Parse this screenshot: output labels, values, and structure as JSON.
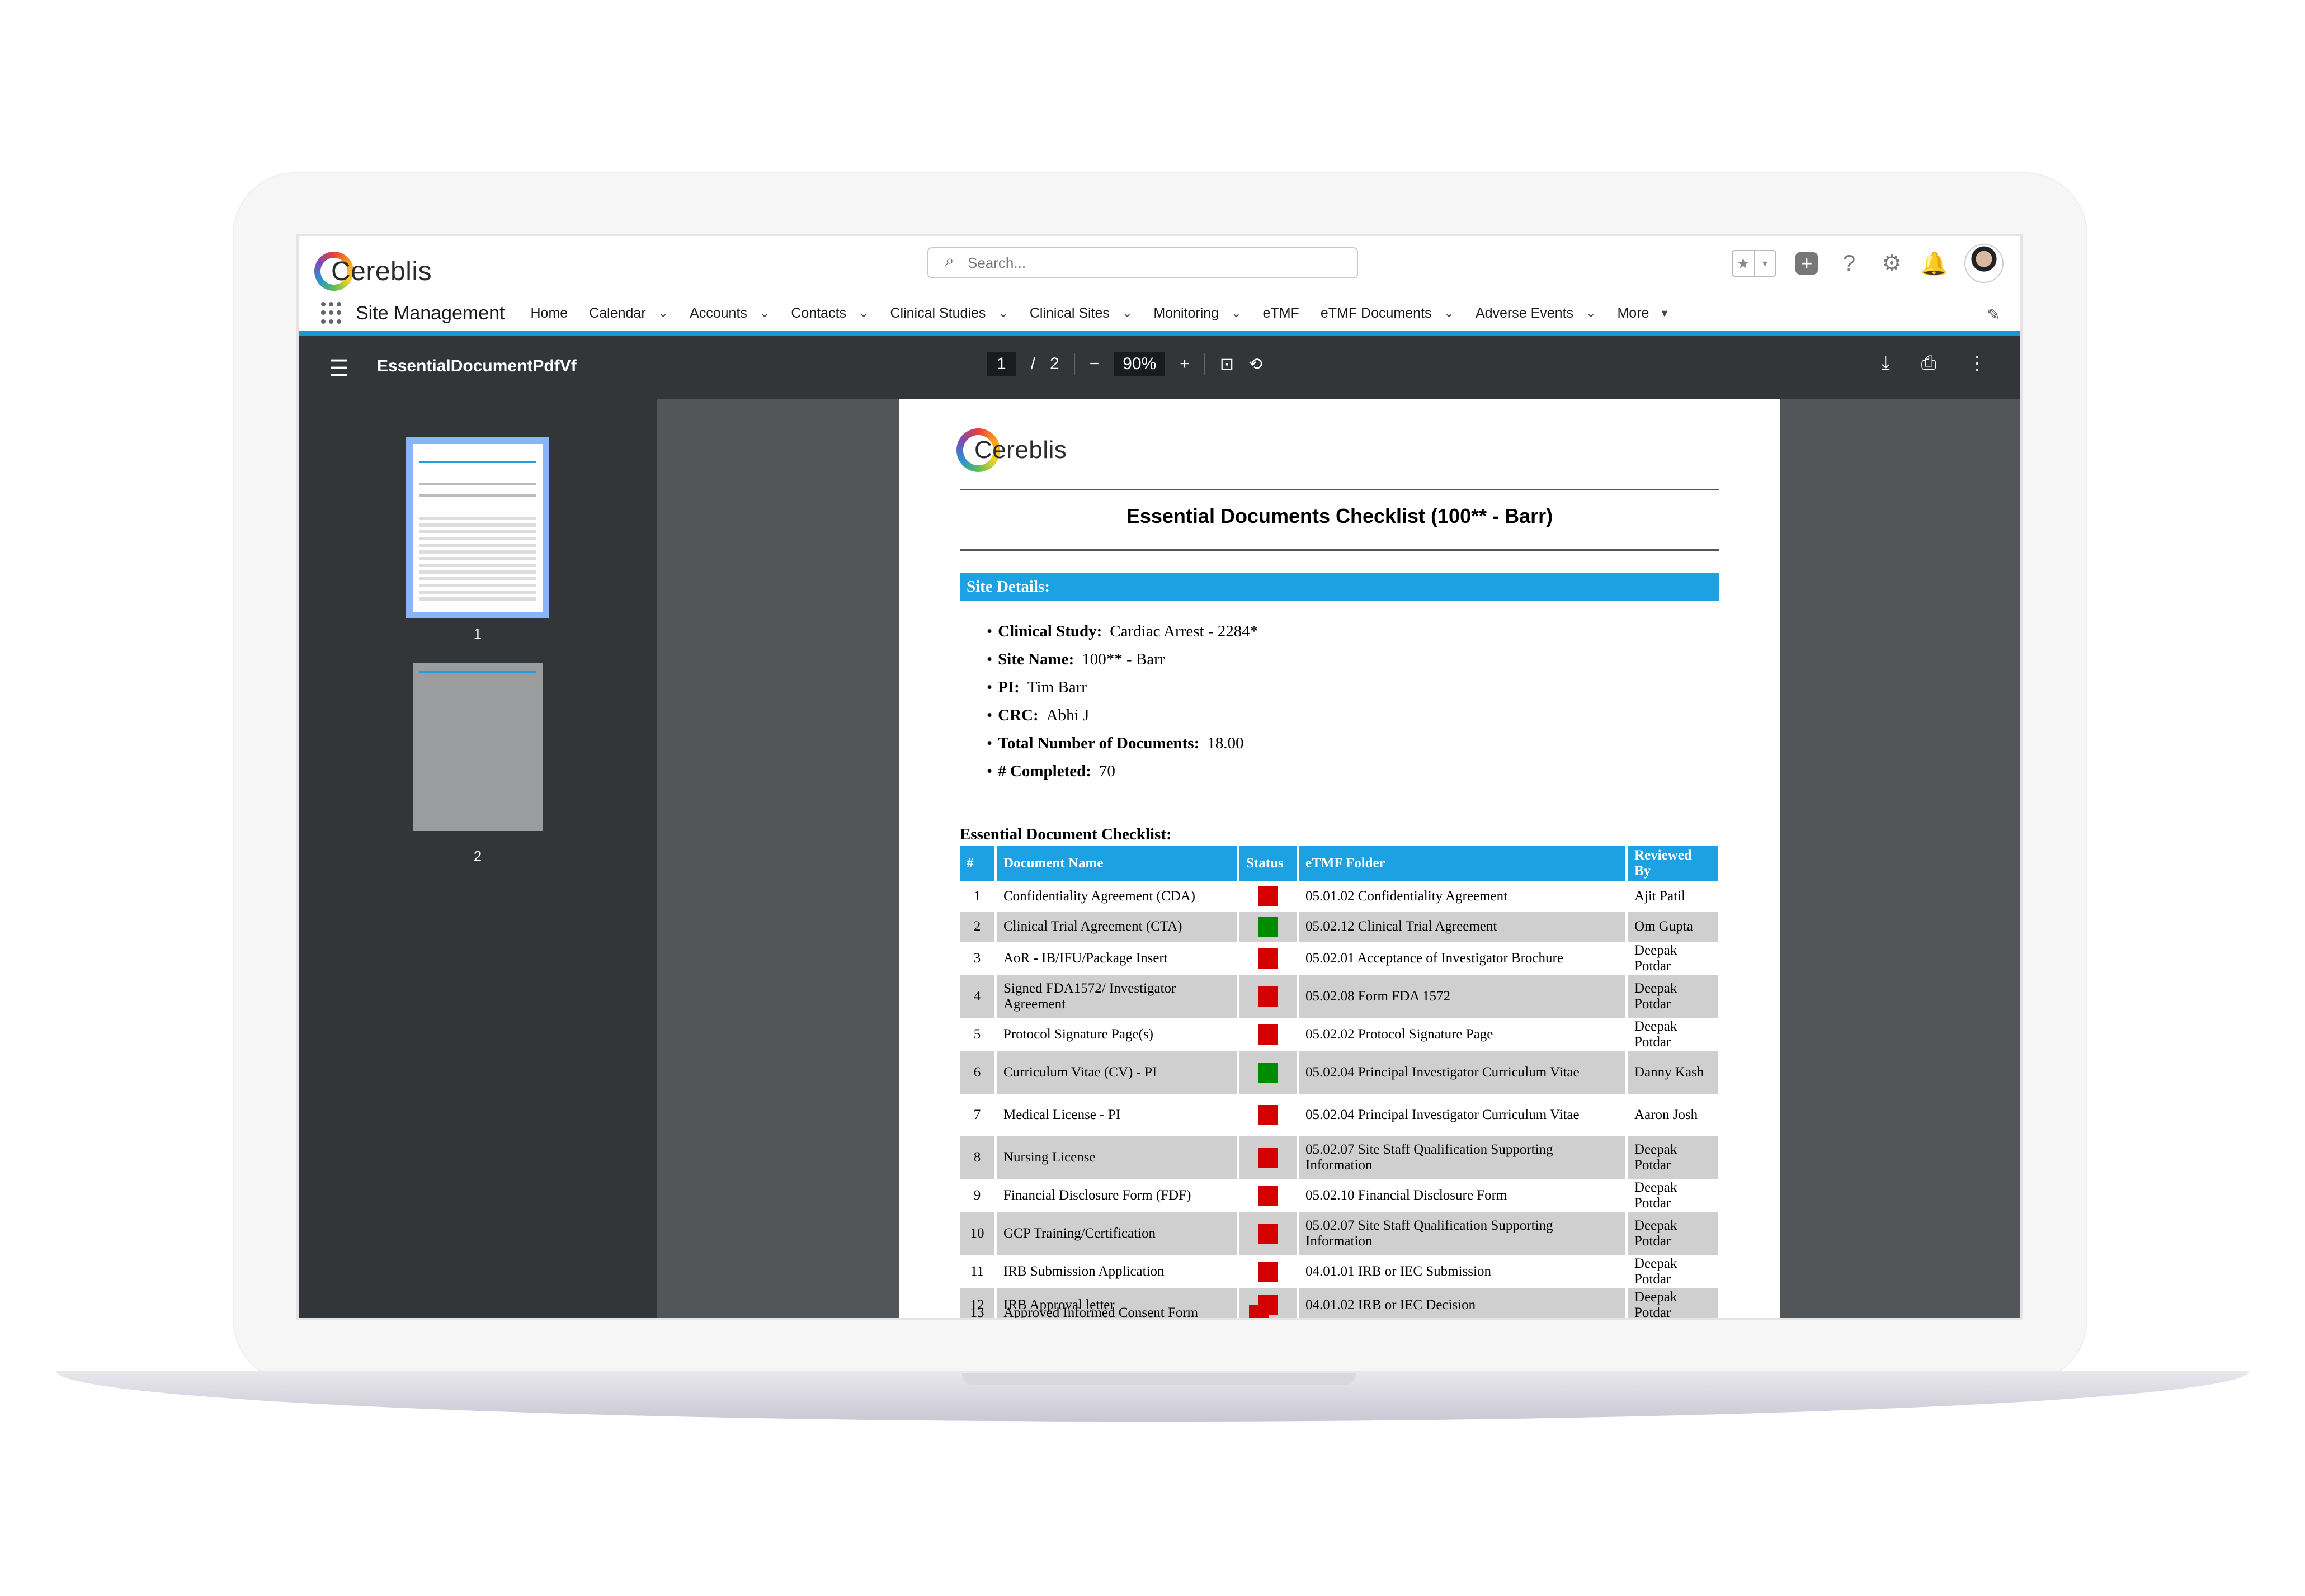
{
  "header": {
    "logo_text": "Cereblis",
    "search_placeholder": "Search...",
    "app_name": "Site Management",
    "nav": [
      {
        "label": "Home",
        "dropdown": false
      },
      {
        "label": "Calendar",
        "dropdown": true
      },
      {
        "label": "Accounts",
        "dropdown": true
      },
      {
        "label": "Contacts",
        "dropdown": true
      },
      {
        "label": "Clinical Studies",
        "dropdown": true
      },
      {
        "label": "Clinical Sites",
        "dropdown": true
      },
      {
        "label": "Monitoring",
        "dropdown": true
      },
      {
        "label": "eTMF",
        "dropdown": false
      },
      {
        "label": "eTMF Documents",
        "dropdown": true
      },
      {
        "label": "Adverse Events",
        "dropdown": true
      },
      {
        "label": "More",
        "dropdown": true
      }
    ],
    "icons": [
      "star-icon",
      "add-icon",
      "help-icon",
      "gear-icon",
      "bell-icon",
      "avatar"
    ]
  },
  "viewer": {
    "file_name": "EssentialDocumentPdfVf",
    "current_page": "1",
    "page_sep": "/",
    "total_pages": "2",
    "zoom": "90%",
    "thumbnails": [
      "1",
      "2"
    ]
  },
  "pdf": {
    "logo_text": "Cereblis",
    "title": "Essential Documents Checklist (100** - Barr)",
    "site_heading": "Site Details:",
    "details": [
      {
        "label": "Clinical Study:",
        "value": "Cardiac Arrest - 2284*"
      },
      {
        "label": "Site Name:",
        "value": "100** - Barr"
      },
      {
        "label": "PI:",
        "value": "Tim Barr"
      },
      {
        "label": "CRC:",
        "value": "Abhi J"
      },
      {
        "label": "Total Number of Documents:",
        "value": "18.00"
      },
      {
        "label": "# Completed:",
        "value": "70"
      }
    ],
    "checklist_title": "Essential Document Checklist:",
    "columns": [
      "#",
      "Document Name",
      "Status",
      "eTMF Folder",
      "Reviewed By"
    ],
    "rows": [
      {
        "num": "1",
        "name": "Confidentiality Agreement (CDA)",
        "status": "red",
        "folder": "05.01.02 Confidentiality Agreement",
        "reviewer": "Ajit Patil"
      },
      {
        "num": "2",
        "name": "Clinical Trial Agreement (CTA)",
        "status": "green",
        "folder": "05.02.12 Clinical Trial Agreement",
        "reviewer": "Om Gupta"
      },
      {
        "num": "3",
        "name": "AoR - IB/IFU/Package Insert",
        "status": "red",
        "folder": "05.02.01 Acceptance of Investigator Brochure",
        "reviewer": "Deepak Potdar"
      },
      {
        "num": "4",
        "name": "Signed FDA1572/ Investigator Agreement",
        "status": "red",
        "folder": "05.02.08 Form FDA 1572",
        "reviewer": "Deepak Potdar"
      },
      {
        "num": "5",
        "name": "Protocol Signature Page(s)",
        "status": "red",
        "folder": "05.02.02 Protocol Signature Page",
        "reviewer": "Deepak Potdar"
      },
      {
        "num": "6",
        "name": "Curriculum Vitae (CV) - PI",
        "status": "green",
        "folder": "05.02.04 Principal Investigator Curriculum Vitae",
        "reviewer": "Danny Kash"
      },
      {
        "num": "7",
        "name": "Medical License - PI",
        "status": "red",
        "folder": "05.02.04 Principal Investigator Curriculum Vitae",
        "reviewer": "Aaron Josh"
      },
      {
        "num": "8",
        "name": "Nursing License",
        "status": "red",
        "folder": "05.02.07 Site Staff Qualification Supporting Information",
        "reviewer": "Deepak Potdar"
      },
      {
        "num": "9",
        "name": "Financial Disclosure Form (FDF)",
        "status": "red",
        "folder": "05.02.10 Financial Disclosure Form",
        "reviewer": "Deepak Potdar"
      },
      {
        "num": "10",
        "name": "GCP Training/Certification",
        "status": "red",
        "folder": "05.02.07 Site Staff Qualification Supporting Information",
        "reviewer": "Deepak Potdar"
      },
      {
        "num": "11",
        "name": "IRB Submission Application",
        "status": "red",
        "folder": "04.01.01 IRB or IEC Submission",
        "reviewer": "Deepak Potdar"
      },
      {
        "num": "12",
        "name": "IRB Approval letter",
        "status": "red",
        "folder": "04.01.02 IRB or IEC Decision",
        "reviewer": "Deepak Potdar"
      }
    ],
    "cut_row": {
      "num": "13",
      "name": "Approved Informed Consent Form",
      "status": "red"
    }
  },
  "colors": {
    "accent": "#1ca1e2",
    "status_red": "#d40000",
    "status_green": "#008c00",
    "toolbar": "#323639"
  }
}
